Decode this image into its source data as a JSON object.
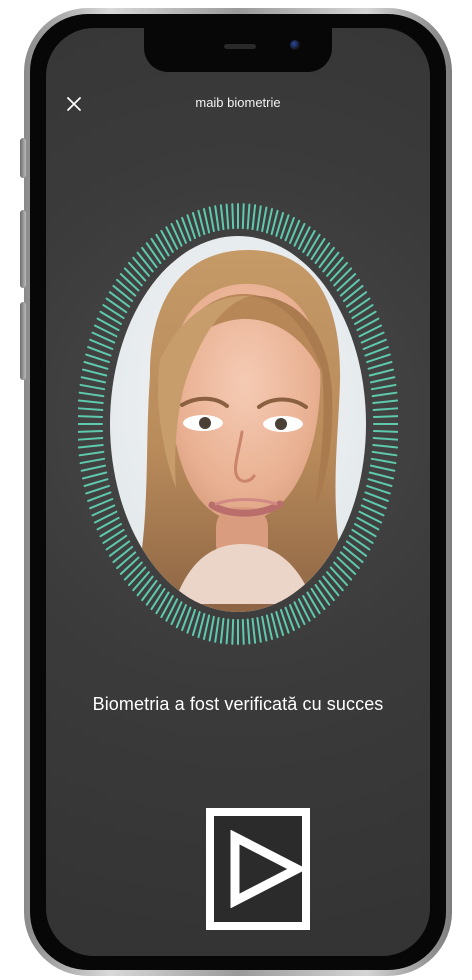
{
  "header": {
    "title": "maib biometrie",
    "close_icon": "close-icon"
  },
  "scanner": {
    "accent_color": "#5ec9ad",
    "verification_progress": 1,
    "state": "success"
  },
  "status": {
    "message": "Biometria a fost verificată cu succes"
  },
  "controls": {
    "play_icon": "play-icon"
  },
  "colors": {
    "screen_background": "#3b3b3b",
    "text": "#ffffff",
    "tick": "#5ec9ad"
  }
}
